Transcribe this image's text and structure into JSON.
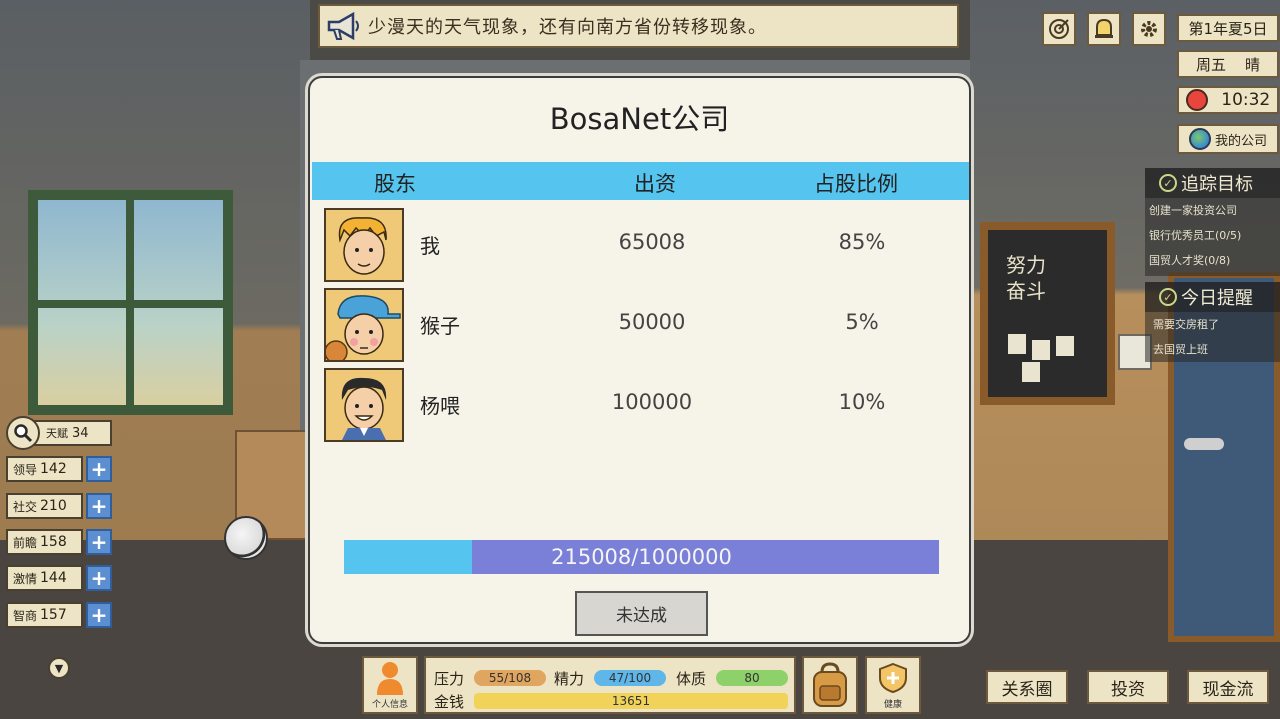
{
  "news": {
    "text": "少漫天的天气现象，还有向南方省份转移现象。"
  },
  "date": {
    "season": "第1年夏5日",
    "weekday_weather": "周五    晴",
    "time": "10:32",
    "my_company": "我的公司"
  },
  "tracking": {
    "title": "追踪目标",
    "items": [
      "创建一家投资公司",
      "银行优秀员工(0/5)",
      "国贸人才奖(0/8)"
    ]
  },
  "today": {
    "title": "今日提醒",
    "items": [
      "需要交房租了",
      "去国贸上班"
    ]
  },
  "board": {
    "text": "努力\n奋斗"
  },
  "stats": {
    "talent": {
      "label": "天赋",
      "value": "34"
    },
    "rows": [
      {
        "label": "领导",
        "value": "142"
      },
      {
        "label": "社交",
        "value": "210"
      },
      {
        "label": "前瞻",
        "value": "158"
      },
      {
        "label": "激情",
        "value": "144"
      },
      {
        "label": "智商",
        "value": "157"
      }
    ]
  },
  "modal": {
    "title": "BosaNet公司",
    "headers": {
      "shareholder": "股东",
      "capital": "出资",
      "ratio": "占股比例"
    },
    "shareholders": [
      {
        "name": "我",
        "capital": "65008",
        "ratio": "85%"
      },
      {
        "name": "猴子",
        "capital": "50000",
        "ratio": "5%"
      },
      {
        "name": "杨喂",
        "capital": "100000",
        "ratio": "10%"
      }
    ],
    "progress": {
      "text": "215008/1000000",
      "fraction": 0.215
    },
    "status_button": "未达成"
  },
  "bottom": {
    "profile_label": "个人信息",
    "pressure_label": "压力",
    "pressure_value": "55/108",
    "energy_label": "精力",
    "energy_value": "47/100",
    "physique_label": "体质",
    "physique_value": "80",
    "money_label": "金钱",
    "money_value": "13651",
    "health_label": "健康",
    "relations_btn": "关系圈",
    "invest_btn": "投资",
    "cashflow_btn": "现金流"
  },
  "colors": {
    "accent_blue": "#55c5ef",
    "progress_bg": "#7a7fd8",
    "plus_blue": "#5b8fd1",
    "pressure": "#e0a55e",
    "energy": "#5fb6e8",
    "physique": "#8ed16b"
  }
}
